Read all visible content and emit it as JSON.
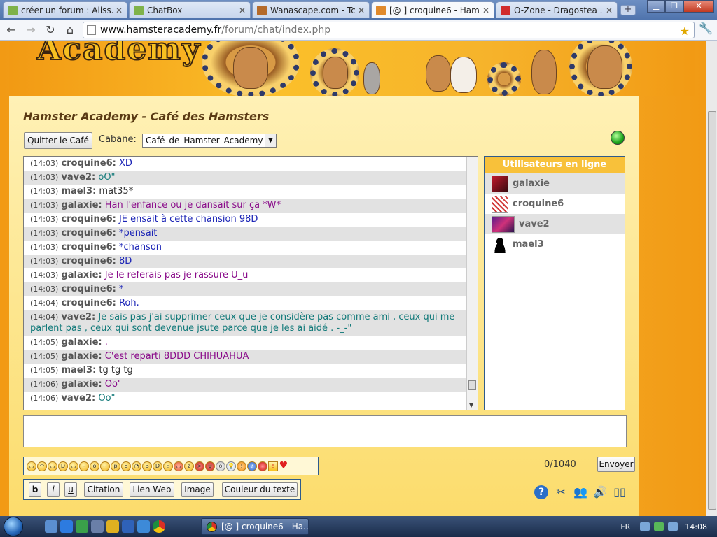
{
  "browser": {
    "tabs": [
      {
        "title": "créer un forum : Aliss...",
        "active": false
      },
      {
        "title": "ChatBox",
        "active": false
      },
      {
        "title": "Wanascape.com - Tc...",
        "active": false
      },
      {
        "title": "[@ ] croquine6 - Ham...",
        "active": true
      },
      {
        "title": "O-Zone - Dragostea ...",
        "active": false
      }
    ],
    "new_tab": "+",
    "url_domain": "www.hamsteracademy.fr",
    "url_path": "/forum/chat/index.php"
  },
  "header": {
    "logo": "Academy"
  },
  "chat_title": "Hamster Academy - Café des Hamsters",
  "controls": {
    "quit_label": "Quitter le Café",
    "cabane_label": "Cabane:",
    "cabane_value": "Café_de_Hamster_Academy"
  },
  "messages": [
    {
      "time": "(14:03)",
      "user": "croquine6:",
      "text": "XD",
      "color": "c-blue"
    },
    {
      "time": "(14:03)",
      "user": "vave2:",
      "text": "oO\"",
      "color": "c-teal"
    },
    {
      "time": "(14:03)",
      "user": "mael3:",
      "text": "mat35*",
      "color": "c-dark"
    },
    {
      "time": "(14:03)",
      "user": "galaxie:",
      "text": "Han l'enfance ou je dansait sur ça *W*",
      "color": "c-purple"
    },
    {
      "time": "(14:03)",
      "user": "croquine6:",
      "text": "JE ensait à cette chansion 98D",
      "color": "c-blue"
    },
    {
      "time": "(14:03)",
      "user": "croquine6:",
      "text": "*pensait",
      "color": "c-blue"
    },
    {
      "time": "(14:03)",
      "user": "croquine6:",
      "text": "*chanson",
      "color": "c-blue"
    },
    {
      "time": "(14:03)",
      "user": "croquine6:",
      "text": "8D",
      "color": "c-blue"
    },
    {
      "time": "(14:03)",
      "user": "galaxie:",
      "text": "Je le referais pas je rassure U_u",
      "color": "c-purple"
    },
    {
      "time": "(14:03)",
      "user": "croquine6:",
      "text": "*",
      "color": "c-blue"
    },
    {
      "time": "(14:04)",
      "user": "croquine6:",
      "text": "Roh.",
      "color": "c-blue"
    },
    {
      "time": "(14:04)",
      "user": "vave2:",
      "text": "Je sais pas j'ai supprimer ceux que je considère pas comme ami , ceux qui me parlent pas , ceux qui sont devenue jsute parce que je les ai aidé . -_-\"",
      "color": "c-teal"
    },
    {
      "time": "(14:05)",
      "user": "galaxie:",
      "text": ".",
      "color": "c-purple"
    },
    {
      "time": "(14:05)",
      "user": "galaxie:",
      "text": "C'est reparti 8DDD CHIHUAHUA",
      "color": "c-purple"
    },
    {
      "time": "(14:05)",
      "user": "mael3:",
      "text": "tg tg tg",
      "color": "c-dark"
    },
    {
      "time": "(14:06)",
      "user": "galaxie:",
      "text": "Oo'",
      "color": "c-purple"
    },
    {
      "time": "(14:06)",
      "user": "vave2:",
      "text": "Oo\"",
      "color": "c-teal"
    }
  ],
  "online": {
    "header": "Utilisateurs en ligne",
    "users": [
      "galaxie",
      "croquine6",
      "vave2",
      "mael3"
    ]
  },
  "composer": {
    "counter": "0/1040",
    "send_label": "Envoyer",
    "format_buttons": [
      "b",
      "i",
      "u",
      "Citation",
      "Lien Web",
      "Image",
      "Couleur du texte"
    ]
  },
  "taskbar": {
    "window_title": "[@ ] croquine6 - Ha...",
    "lang": "FR",
    "time": "14:08"
  },
  "colors": {
    "accent": "#f8c13a",
    "link_border": "#2e5b8c",
    "status": "#1ca31c"
  }
}
